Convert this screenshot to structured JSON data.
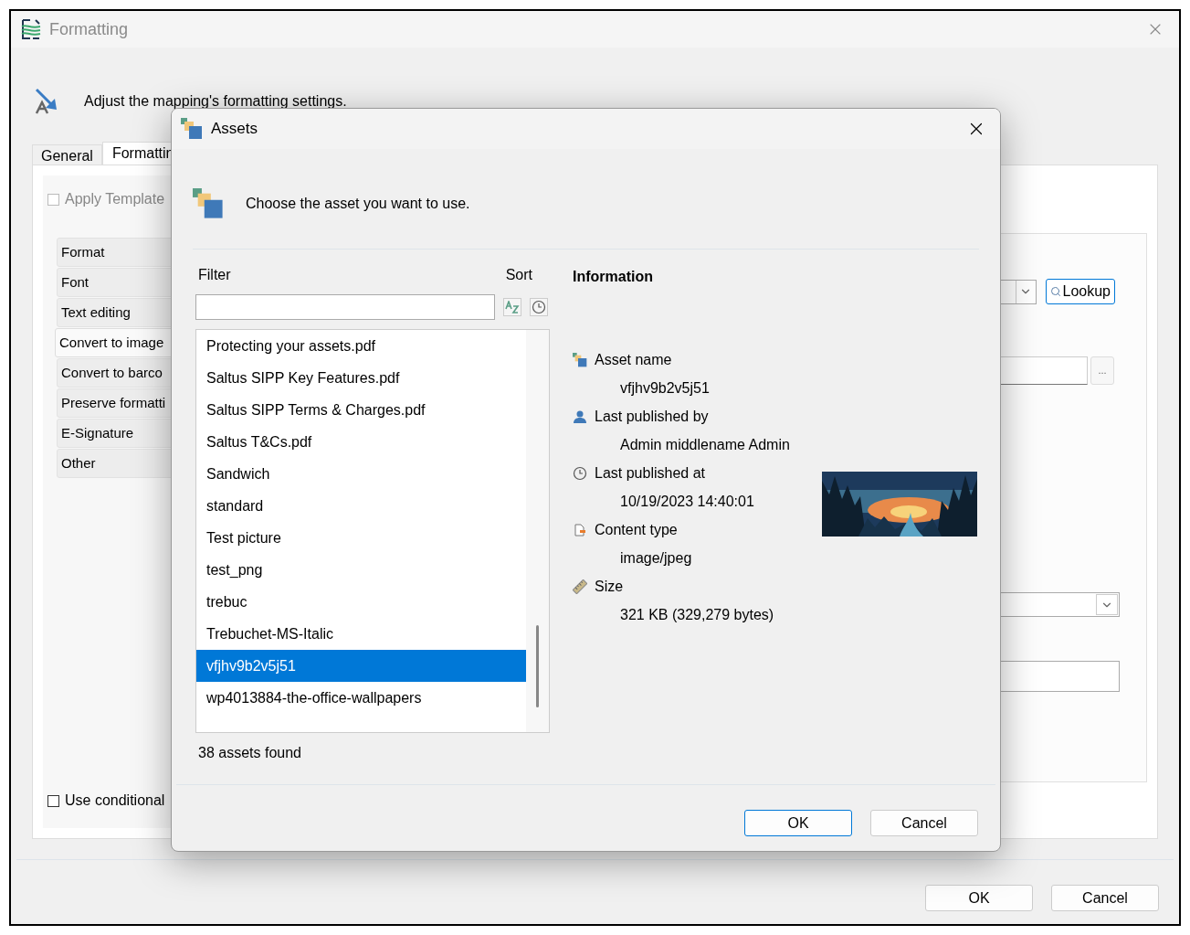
{
  "window": {
    "title": "Formatting"
  },
  "header": {
    "text": "Adjust the mapping's formatting settings."
  },
  "tabs": [
    {
      "label": "General",
      "selected": false
    },
    {
      "label": "Formattin",
      "selected": true
    }
  ],
  "apply_template": {
    "label": "Apply Template",
    "checked": false
  },
  "nav_items": [
    {
      "label": "Format",
      "selected": false
    },
    {
      "label": "Font",
      "selected": false
    },
    {
      "label": "Text editing",
      "selected": false
    },
    {
      "label": "Convert to image",
      "selected": true
    },
    {
      "label": "Convert to barco",
      "selected": false
    },
    {
      "label": "Preserve formatti",
      "selected": false
    },
    {
      "label": "E-Signature",
      "selected": false
    },
    {
      "label": "Other",
      "selected": false
    }
  ],
  "use_conditional": {
    "label": "Use conditional",
    "checked": false
  },
  "right_panel": {
    "lookup_button": "Lookup",
    "browse_button": "..."
  },
  "buttons": [
    "OK",
    "Cancel"
  ],
  "dialog": {
    "title": "Assets",
    "instruction": "Choose the asset you want to use.",
    "filter_label": "Filter",
    "sort_label": "Sort",
    "information_heading": "Information",
    "assets": [
      {
        "name": "Protecting your assets.pdf",
        "selected": false
      },
      {
        "name": "Saltus SIPP Key Features.pdf",
        "selected": false
      },
      {
        "name": "Saltus SIPP Terms & Charges.pdf",
        "selected": false
      },
      {
        "name": "Saltus T&Cs.pdf",
        "selected": false
      },
      {
        "name": "Sandwich",
        "selected": false
      },
      {
        "name": "standard",
        "selected": false
      },
      {
        "name": "Test picture",
        "selected": false
      },
      {
        "name": "test_png",
        "selected": false
      },
      {
        "name": "trebuc",
        "selected": false
      },
      {
        "name": "Trebuchet-MS-Italic",
        "selected": false
      },
      {
        "name": "vfjhv9b2v5j51",
        "selected": true
      },
      {
        "name": "wp4013884-the-office-wallpapers",
        "selected": false
      }
    ],
    "status": "38 assets found",
    "info": [
      {
        "kind": "asset",
        "label": "Asset name",
        "value": "vfjhv9b2v5j51"
      },
      {
        "kind": "user",
        "label": "Last published by",
        "value": "Admin middlename Admin"
      },
      {
        "kind": "clock",
        "label": "Last published at",
        "value": "10/19/2023 14:40:01"
      },
      {
        "kind": "type",
        "label": "Content type",
        "value": "image/jpeg"
      },
      {
        "kind": "size",
        "label": "Size",
        "value": "321 KB (329,279 bytes)"
      }
    ],
    "buttons": [
      {
        "label": "OK",
        "default": true
      },
      {
        "label": "Cancel",
        "default": false
      }
    ]
  }
}
